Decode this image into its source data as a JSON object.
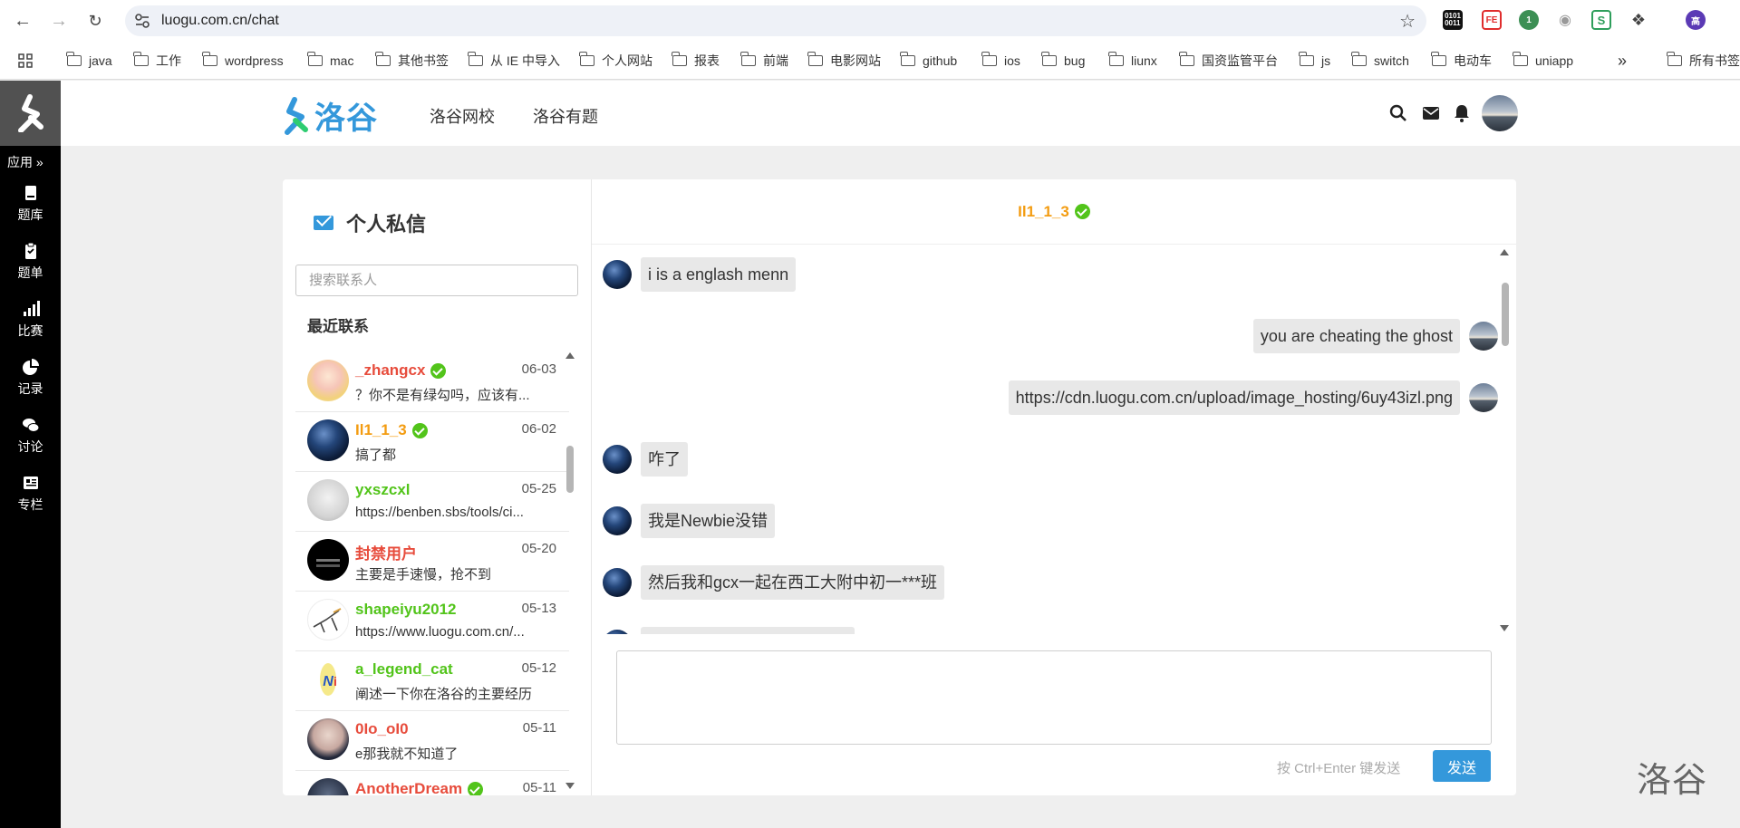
{
  "browser": {
    "url": "luogu.com.cn/chat",
    "bookmarks": [
      "java",
      "工作",
      "wordpress",
      "mac",
      "其他书签",
      "从 IE 中导入",
      "个人网站",
      "报表",
      "前端",
      "电影网站",
      "github",
      "ios",
      "bug",
      "liunx",
      "国资监管平台",
      "js",
      "switch",
      "电动车",
      "uniapp"
    ],
    "more": "»",
    "all_bookmarks": "所有书签",
    "profile_initial": "高",
    "ext_badge": "1"
  },
  "sidebar": {
    "apps_label": "应用 »",
    "items": [
      {
        "label": "题库",
        "icon": "book-icon"
      },
      {
        "label": "题单",
        "icon": "clipboard-icon"
      },
      {
        "label": "比赛",
        "icon": "bar-chart-icon"
      },
      {
        "label": "记录",
        "icon": "pie-chart-icon"
      },
      {
        "label": "讨论",
        "icon": "comments-icon"
      },
      {
        "label": "专栏",
        "icon": "newspaper-icon"
      }
    ]
  },
  "header": {
    "brand": "洛谷",
    "nav": [
      "洛谷网校",
      "洛谷有题"
    ]
  },
  "pm": {
    "title": "个人私信",
    "search_placeholder": "搜索联系人",
    "recent_label": "最近联系",
    "contacts": [
      {
        "name": "_zhangcx",
        "date": "06-03",
        "preview": "？你不是有绿勾吗，应该有...",
        "color": "#e74c3c",
        "verified": true,
        "avatar": "anime"
      },
      {
        "name": "Il1_1_3",
        "date": "06-02",
        "preview": "搞了都",
        "color": "#f39c11",
        "verified": true,
        "avatar": "moon"
      },
      {
        "name": "yxszcxl",
        "date": "05-25",
        "preview": "https://benben.sbs/tools/ci...",
        "color": "#52c41a",
        "verified": false,
        "avatar": "sketch"
      },
      {
        "name": "封禁用户",
        "date": "05-20",
        "preview": "主要是手速慢，抢不到",
        "color": "#e74c3c",
        "verified": false,
        "avatar": "banned"
      },
      {
        "name": "shapeiyu2012",
        "date": "05-13",
        "preview": "https://www.luogu.com.cn/...",
        "color": "#52c41a",
        "verified": false,
        "avatar": "doodle"
      },
      {
        "name": "a_legend_cat",
        "date": "05-12",
        "preview": "阐述一下你在洛谷的主要经历",
        "color": "#52c41a",
        "verified": false,
        "avatar": "ni"
      },
      {
        "name": "0Io_oI0",
        "date": "05-11",
        "preview": "e那我就不知道了",
        "color": "#e74c3c",
        "verified": false,
        "avatar": "mask"
      },
      {
        "name": "AnotherDream",
        "date": "05-11",
        "preview": "",
        "color": "#e74c3c",
        "verified": true,
        "avatar": "dark"
      }
    ]
  },
  "chat": {
    "partner": "Il1_1_3",
    "messages": [
      {
        "side": "left",
        "text": "i is a englash menn"
      },
      {
        "side": "right",
        "text": "you are cheating the ghost"
      },
      {
        "side": "right",
        "text": "https://cdn.luogu.com.cn/upload/image_hosting/6uy43izl.png"
      },
      {
        "side": "left",
        "text": "咋了"
      },
      {
        "side": "left",
        "text": "我是Newbie没错"
      },
      {
        "side": "left",
        "text": "然后我和gcx一起在西工大附中初一***班"
      }
    ],
    "hint": "按 Ctrl+Enter 键发送",
    "send_label": "发送"
  },
  "watermark": "洛谷",
  "colors": {
    "accent": "#3498db",
    "orange": "#f39c11",
    "green": "#52c41a",
    "red": "#e74c3c"
  }
}
